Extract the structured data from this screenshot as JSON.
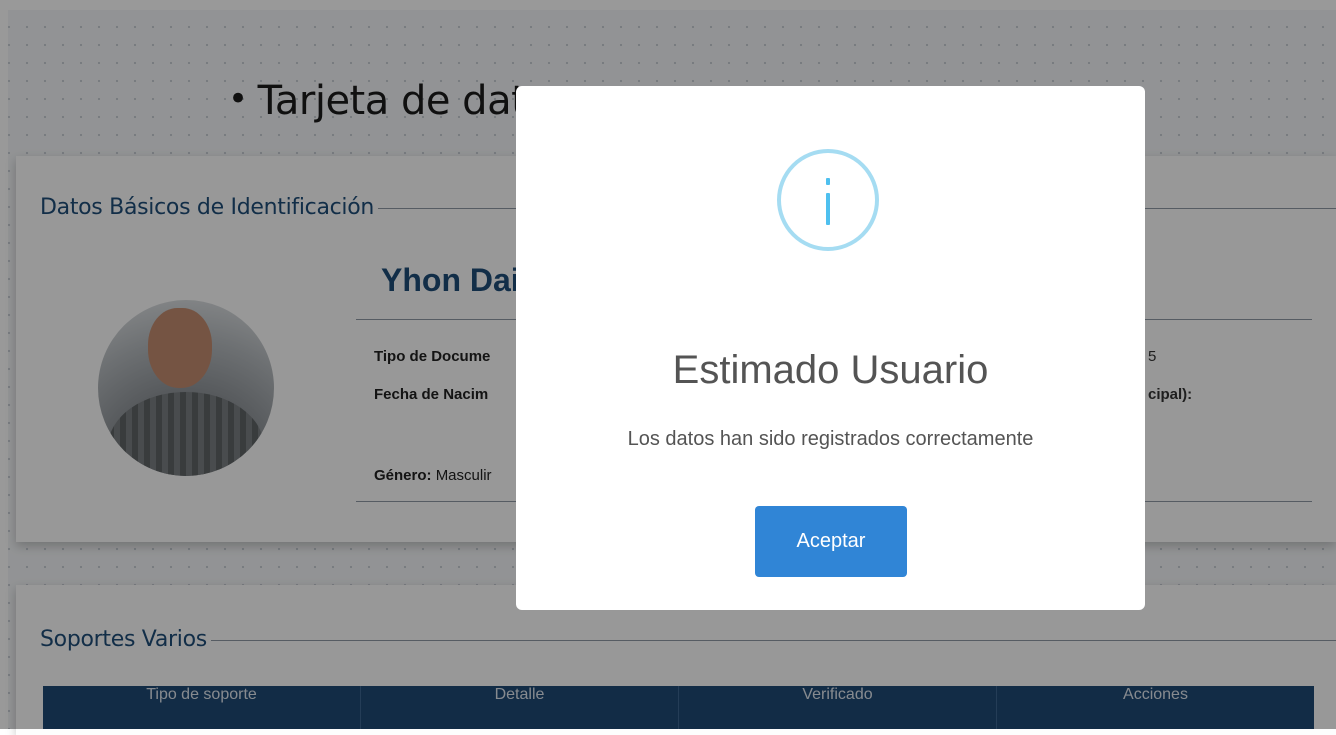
{
  "page": {
    "title": "Tarjeta de datos de carga de información",
    "title_visible": "Tarjeta de dat",
    "bullet": "•"
  },
  "basic_card": {
    "legend": "Datos Básicos de Identificación",
    "name_visible": "Yhon Dai",
    "field_doc_type_label": "Tipo de Docume",
    "field_birth_label": "Fecha de Nacim",
    "field_gender_label": "Género:",
    "field_gender_value": "Masculir",
    "right_value_1": "5",
    "right_value_2": "cipal):"
  },
  "support_card": {
    "legend": "Soportes Varios",
    "columns": [
      "Tipo de soporte",
      "Detalle",
      "Verificado",
      "Acciones"
    ]
  },
  "modal": {
    "icon": "info-icon",
    "title": "Estimado Usuario",
    "message": "Los datos han sido registrados correctamente",
    "button_label": "Aceptar"
  },
  "colors": {
    "accent": "#1f4e79",
    "button": "#3085d6",
    "icon_ring": "#a5dcf2",
    "icon_fill": "#4ec0ef",
    "table_header": "#1f4a75"
  }
}
